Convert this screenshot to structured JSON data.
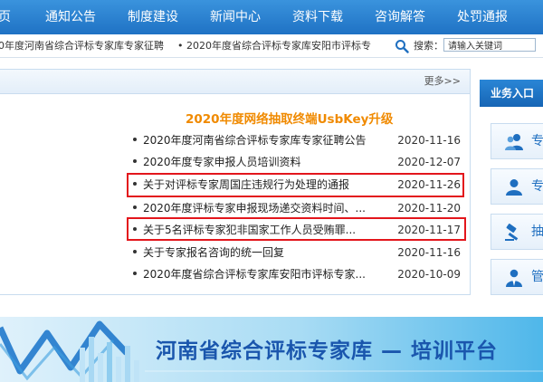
{
  "nav": {
    "items": [
      "页",
      "通知公告",
      "制度建设",
      "新闻中心",
      "资料下载",
      "咨询解答",
      "处罚通报"
    ]
  },
  "ticker": {
    "item1": "0年度河南省综合评标专家库专家征聘",
    "item2": "• 2020年度省综合评标专家库安阳市评标专",
    "search_label": "搜索：",
    "search_placeholder": "请输入关键词"
  },
  "panel": {
    "more_label": "更多>>",
    "promo_title": "2020年度网络抽取终端UsbKey升级",
    "news": [
      {
        "title": "2020年度河南省综合评标专家库专家征聘公告",
        "date": "2020-11-16"
      },
      {
        "title": "2020年度专家申报人员培训资料",
        "date": "2020-12-07"
      },
      {
        "title": "关于对评标专家周国庄违规行为处理的通报",
        "date": "2020-11-26"
      },
      {
        "title": "2020年度评标专家申报现场递交资料时间、...",
        "date": "2020-11-20"
      },
      {
        "title": "关于5名评标专家犯非国家工作人员受贿罪...",
        "date": "2020-11-17"
      },
      {
        "title": "关于专家报名咨询的统一回复",
        "date": "2020-11-16"
      },
      {
        "title": "2020年度省综合评标专家库安阳市评标专家...",
        "date": "2020-10-09"
      }
    ]
  },
  "sidebar": {
    "title": "业务入口",
    "buttons": [
      {
        "label": "专",
        "icon": "users-icon"
      },
      {
        "label": "专",
        "icon": "user-icon"
      },
      {
        "label": "抽",
        "icon": "gavel-icon"
      },
      {
        "label": "管",
        "icon": "manager-icon"
      }
    ]
  },
  "banner": {
    "text": "河南省综合评标专家库 — 培训平台"
  },
  "colors": {
    "nav_blue": "#1f72c4",
    "highlight_red": "#e3161c",
    "promo_orange": "#f08a00",
    "banner_text": "#1a56ad"
  }
}
